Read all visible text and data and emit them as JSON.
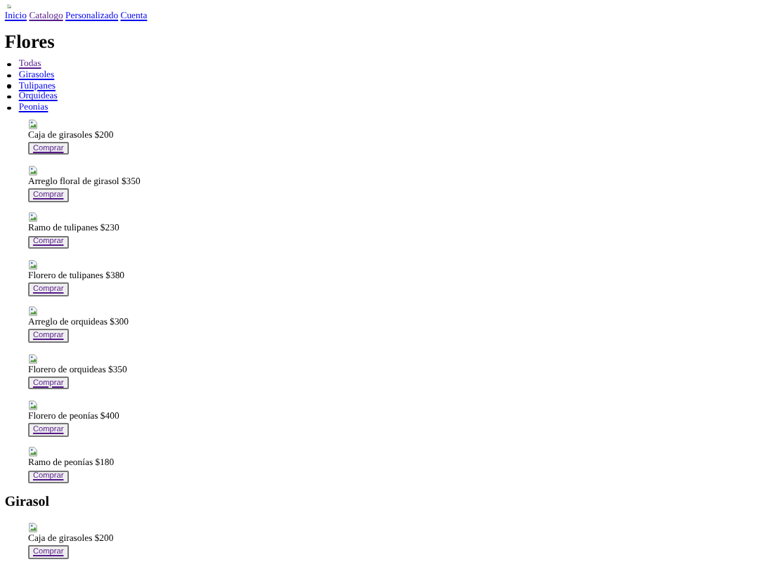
{
  "nav": [
    {
      "label": "Inicio",
      "visited": false
    },
    {
      "label": "Catalogo",
      "visited": true
    },
    {
      "label": "Personalizado",
      "visited": false
    },
    {
      "label": "Cuenta",
      "visited": false
    }
  ],
  "title": "Flores",
  "filters": [
    {
      "label": "Todas",
      "visited": true
    },
    {
      "label": "Girasoles",
      "visited": false
    },
    {
      "label": "Tulipanes",
      "visited": false
    },
    {
      "label": "Orquideas",
      "visited": false
    },
    {
      "label": "Peonias",
      "visited": false
    }
  ],
  "sections": [
    {
      "products": [
        {
          "name": "Caja de girasoles $200",
          "button": "Comprar"
        },
        {
          "name": "Arreglo floral de girasol $350",
          "button": "Comprar"
        },
        {
          "name": "Ramo de tulipanes $230",
          "button": "Comprar"
        },
        {
          "name": "Florero de tulipanes $380",
          "button": "Comprar"
        },
        {
          "name": "Arreglo de orquideas $300",
          "button": "Comprar"
        },
        {
          "name": "Florero de orquideas $350",
          "button": "Comprar"
        },
        {
          "name": "Florero de peonías $400",
          "button": "Comprar"
        },
        {
          "name": "Ramo de peonías $180",
          "button": "Comprar"
        }
      ]
    },
    {
      "heading": "Girasol",
      "products": [
        {
          "name": "Caja de girasoles $200",
          "button": "Comprar"
        }
      ]
    }
  ]
}
